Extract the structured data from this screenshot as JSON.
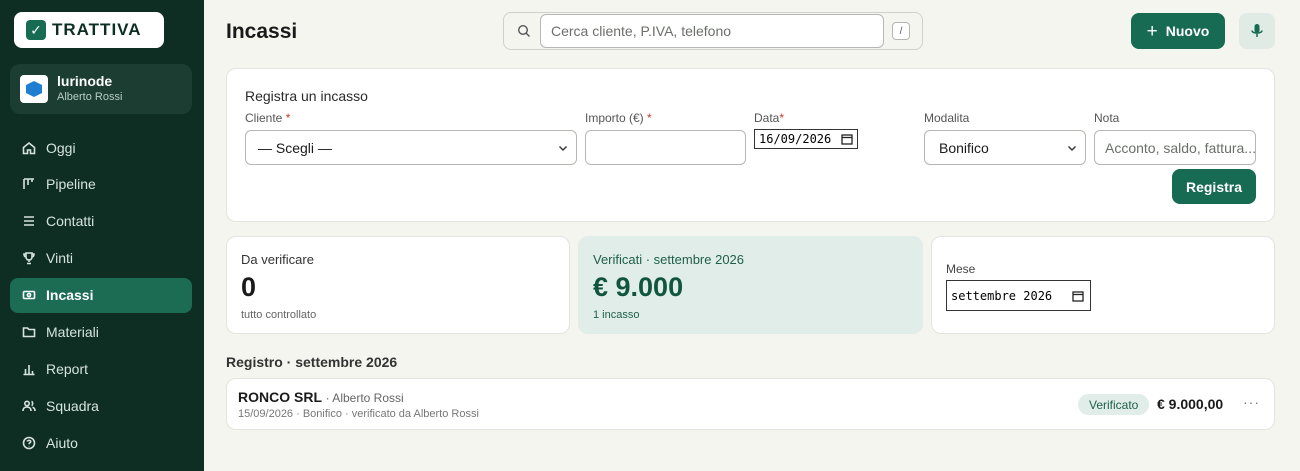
{
  "brand": {
    "name": "TRATTIVA"
  },
  "workspace": {
    "name": "lurinode",
    "user": "Alberto Rossi"
  },
  "nav": [
    {
      "label": "Oggi",
      "icon": "home-icon",
      "active": false
    },
    {
      "label": "Pipeline",
      "icon": "pipeline-icon",
      "active": false
    },
    {
      "label": "Contatti",
      "icon": "list-icon",
      "active": false
    },
    {
      "label": "Vinti",
      "icon": "trophy-icon",
      "active": false
    },
    {
      "label": "Incassi",
      "icon": "banknote-icon",
      "active": true
    },
    {
      "label": "Materiali",
      "icon": "folder-icon",
      "active": false
    },
    {
      "label": "Report",
      "icon": "bar-chart-icon",
      "active": false
    },
    {
      "label": "Squadra",
      "icon": "users-icon",
      "active": false
    },
    {
      "label": "Aiuto",
      "icon": "help-icon",
      "active": false
    }
  ],
  "header": {
    "title": "Incassi",
    "search_placeholder": "Cerca cliente, P.IVA, telefono",
    "search_shortcut": "/",
    "new_label": "Nuovo"
  },
  "form": {
    "title": "Registra un incasso",
    "cliente_label": "Cliente",
    "cliente_value": "— Scegli —",
    "importo_label": "Importo (€)",
    "importo_value": "",
    "data_label": "Data",
    "data_value": "16/09/2026",
    "modalita_label": "Modalita",
    "modalita_value": "Bonifico",
    "nota_label": "Nota",
    "nota_placeholder": "Acconto, saldo, fattura...",
    "required_mark": "*",
    "submit_label": "Registra"
  },
  "stats": {
    "pending": {
      "label": "Da verificare",
      "value": "0",
      "sub": "tutto controllato"
    },
    "verified": {
      "label": "Verificati · settembre 2026",
      "value": "€ 9.000",
      "sub": "1 incasso"
    },
    "month": {
      "label": "Mese",
      "value": "settembre 2026"
    }
  },
  "registry": {
    "title": "Registro · settembre 2026",
    "rows": [
      {
        "client": "RONCO SRL",
        "owner": "· Alberto Rossi",
        "meta": "15/09/2026 · Bonifico · verificato da Alberto Rossi",
        "status": "Verificato",
        "amount": "€ 9.000,00",
        "more": "···"
      }
    ]
  },
  "colors": {
    "sidebar": "#0e2e24",
    "accent": "#176b52",
    "verified_bg": "#e0ede8"
  }
}
